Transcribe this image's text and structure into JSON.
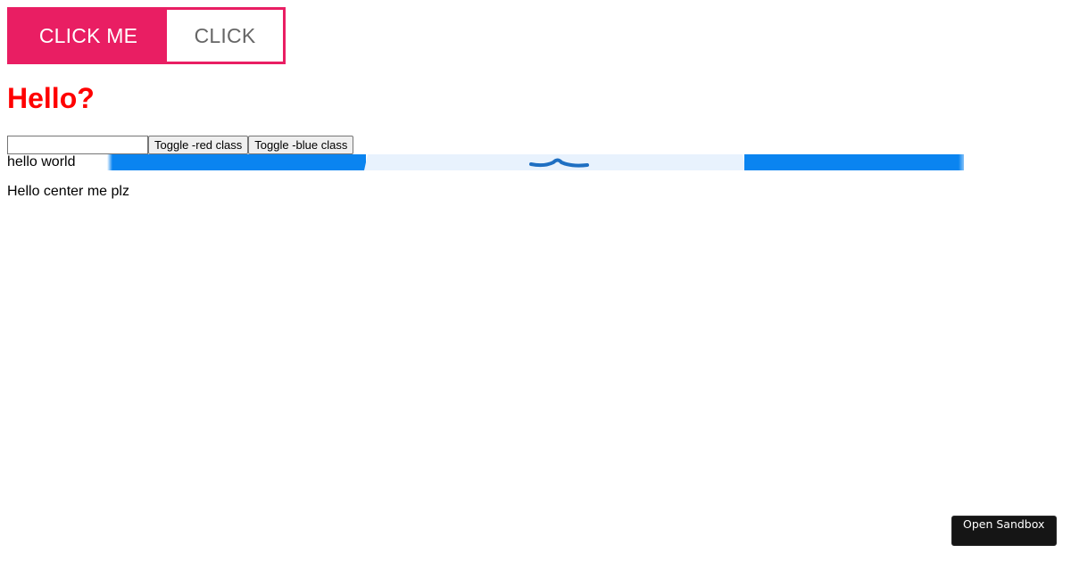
{
  "button_group": {
    "primary_label": "CLICK ME",
    "secondary_label": "CLICK",
    "accent_color": "#e91e63"
  },
  "heading": {
    "text": "Hello?",
    "color": "#ff0000"
  },
  "controls": {
    "input_value": "",
    "toggle_red_label": "Toggle -red class",
    "toggle_blue_label": "Toggle -blue class"
  },
  "hello_world": "hello world",
  "center_text": "Hello center me plz",
  "banner": {
    "colors": {
      "blue": "#0a84f0",
      "light": "#e8f2fd",
      "mark": "#1e6fc2"
    }
  },
  "sandbox": {
    "label": "Open Sandbox"
  }
}
